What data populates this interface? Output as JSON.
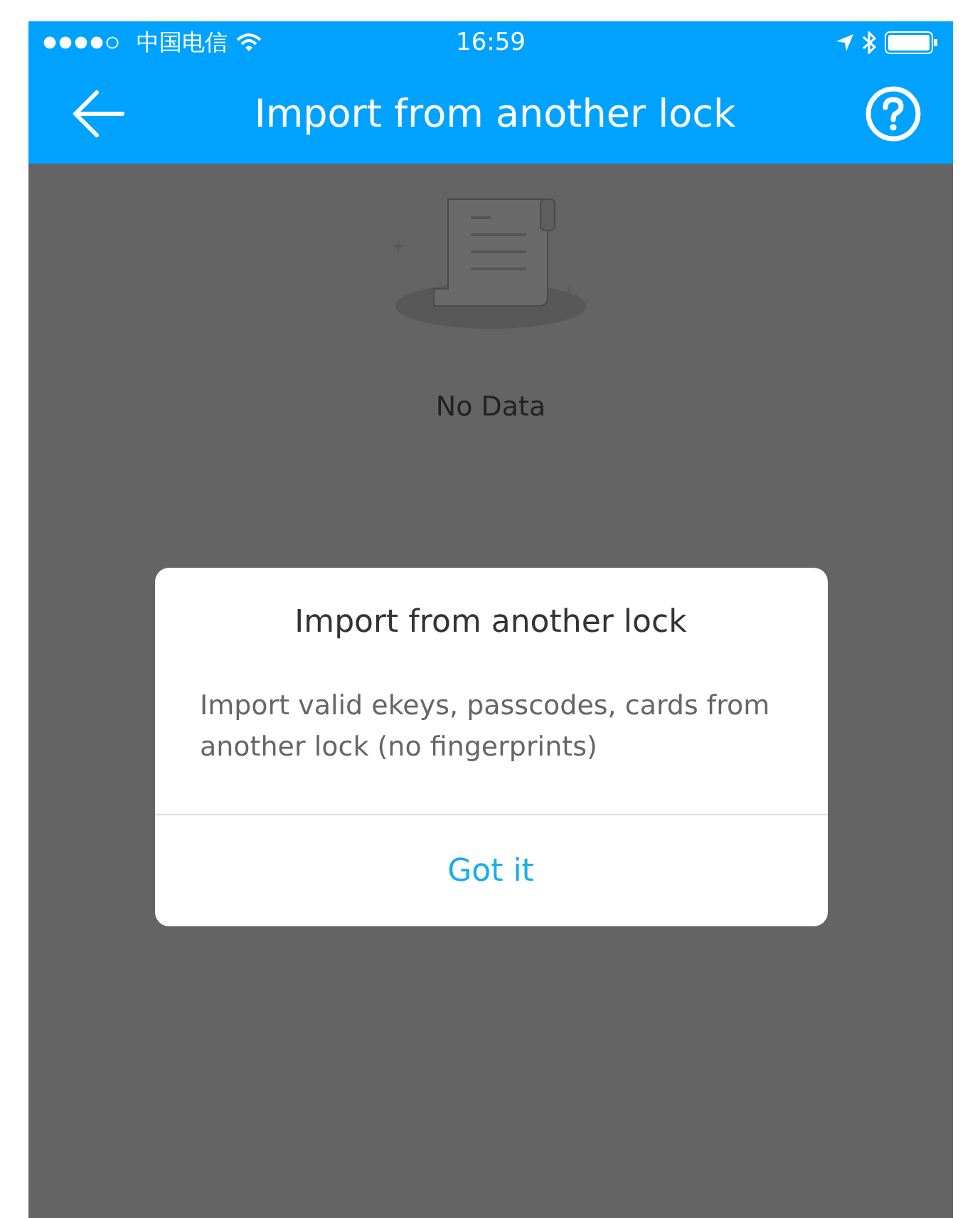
{
  "status_bar": {
    "carrier": "中国电信",
    "time": "16:59"
  },
  "nav_bar": {
    "title": "Import from another lock"
  },
  "empty_state": {
    "text": "No Data"
  },
  "dialog": {
    "title": "Import from another lock",
    "message": "Import valid ekeys, passcodes, cards from another lock (no fingerprints)",
    "button": "Got it"
  }
}
